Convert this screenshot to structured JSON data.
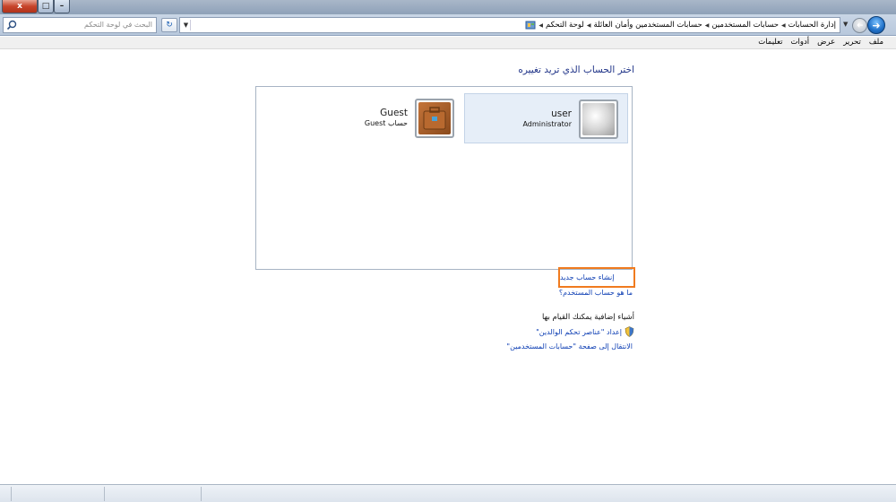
{
  "window": {
    "close_glyph": "x",
    "restore_glyph": "□",
    "minimize_glyph": "–"
  },
  "navbar": {
    "search_placeholder": "البحث في لوحة التحكم",
    "refresh_glyph": "↻",
    "back_glyph": "➜",
    "forward_glyph": "➜",
    "breadcrumb": [
      "لوحة التحكم",
      "حسابات المستخدمين وأمان العائلة",
      "حسابات المستخدمين",
      "إدارة الحسابات"
    ]
  },
  "menu": {
    "items": [
      "ملف",
      "تحرير",
      "عرض",
      "أدوات",
      "تعليمات"
    ]
  },
  "content": {
    "title": "اختر الحساب الذي تريد تغييره",
    "accounts": [
      {
        "name": "user",
        "type": "Administrator"
      },
      {
        "name": "Guest",
        "type": "حساب Guest"
      }
    ],
    "create_account": "إنشاء حساب جديد",
    "what_is_account": "ما هو حساب المستخدم؟",
    "extra_heading": "أشياء إضافية يمكنك القيام بها",
    "parental_controls": "إعداد \"عناصر تحكم الوالدين\"",
    "go_to_user_accounts": "الانتقال إلى صفحة \"حسابات المستخدمين\""
  },
  "colors": {
    "link": "#0e3fb4",
    "title": "#1e3287",
    "highlight_border": "#f07b1f",
    "selected_tile": "#e6eef8"
  }
}
